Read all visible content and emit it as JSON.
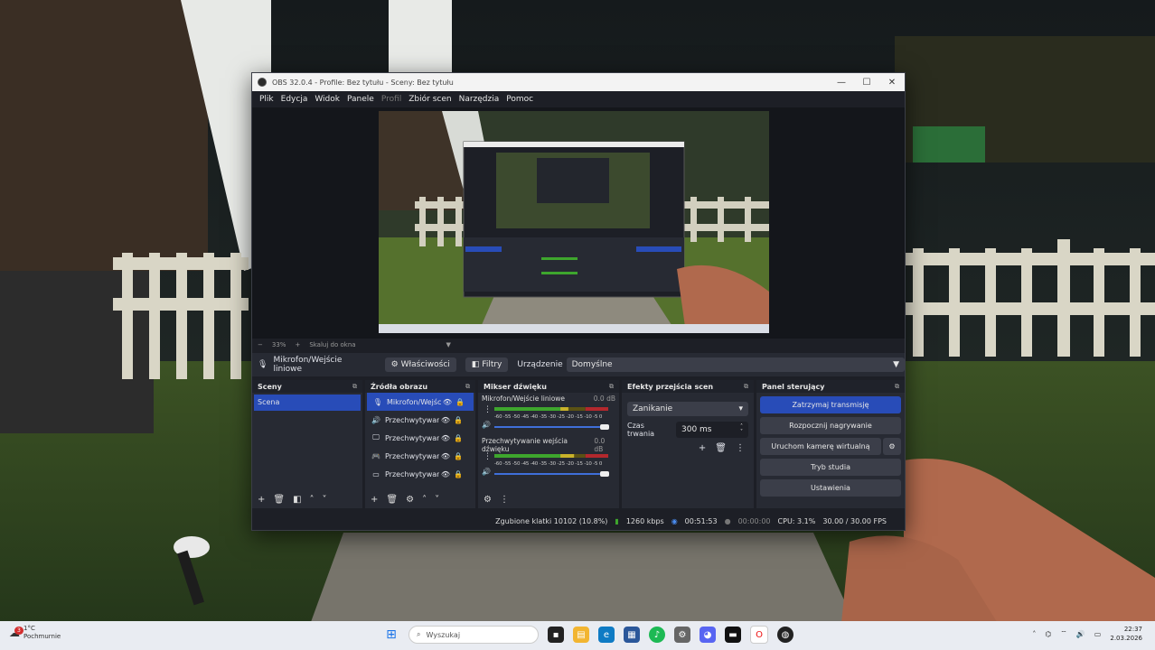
{
  "window": {
    "title": "OBS 32.0.4 - Profile: Bez tytułu - Sceny: Bez tytułu",
    "controls": [
      "—",
      "☐",
      "✕"
    ]
  },
  "menu": [
    {
      "label": "Plik",
      "enabled": true
    },
    {
      "label": "Edycja",
      "enabled": true
    },
    {
      "label": "Widok",
      "enabled": true
    },
    {
      "label": "Panele",
      "enabled": true
    },
    {
      "label": "Profil",
      "enabled": false
    },
    {
      "label": "Zbiór scen",
      "enabled": true
    },
    {
      "label": "Narzędzia",
      "enabled": true
    },
    {
      "label": "Pomoc",
      "enabled": true
    }
  ],
  "zoom": {
    "minus": "−",
    "value": "33%",
    "plus": "+",
    "scale_label": "Skaluj do okna"
  },
  "source_bar": {
    "source_name": "Mikrofon/Wejście liniowe",
    "properties": "Właściwości",
    "filters": "Filtry",
    "device_label": "Urządzenie",
    "device_value": "Domyślne"
  },
  "scenes": {
    "title": "Sceny",
    "items": [
      "Scena"
    ]
  },
  "sources": {
    "title": "Źródła obrazu",
    "items": [
      {
        "label": "Mikrofon/Wejście liniowe",
        "icon": "microphone-icon",
        "glyph": "🎙",
        "active": true
      },
      {
        "label": "Przechwytywanie wejścia dźwięku",
        "icon": "speaker-icon",
        "glyph": "🔊",
        "active": false
      },
      {
        "label": "Przechwytywanie ekranu",
        "icon": "monitor-icon",
        "glyph": "🖵",
        "active": false
      },
      {
        "label": "Przechwytywanie gry",
        "icon": "gamepad-icon",
        "glyph": "🎮",
        "active": false
      },
      {
        "label": "Przechwytywanie okna",
        "icon": "window-icon",
        "glyph": "▭",
        "active": false
      }
    ]
  },
  "mixer": {
    "title": "Mikser dźwięku",
    "channels": [
      {
        "name": "Mikrofon/Wejście liniowe",
        "db": "0.0 dB",
        "level": 0.65
      },
      {
        "name": "Przechwytywanie wejścia dźwięku",
        "db": "0.0 dB",
        "level": 0.7
      }
    ],
    "ticks": "-60 -55 -50 -45 -40 -35 -30 -25 -20 -15 -10 -5 0"
  },
  "transitions": {
    "title": "Efekty przejścia scen",
    "selected": "Zanikanie",
    "duration_label": "Czas trwania",
    "duration_value": "300 ms"
  },
  "controls": {
    "title": "Panel sterujący",
    "stop_stream": "Zatrzymaj transmisję",
    "start_record": "Rozpocznij nagrywanie",
    "virtual_cam": "Uruchom kamerę wirtualną",
    "studio_mode": "Tryb studia",
    "settings": "Ustawienia"
  },
  "status": {
    "dropped": "Zgubione klatki 10102 (10.8%)",
    "bitrate": "1260 kbps",
    "stream_time": "00:51:53",
    "record_time": "00:00:00",
    "cpu": "CPU: 3.1%",
    "fps": "30.00 / 30.00 FPS"
  },
  "taskbar": {
    "weather_temp": "1°C",
    "weather_desc": "Pochmurnie",
    "weather_badge": "3",
    "search_placeholder": "Wyszukaj",
    "time": "22:37",
    "date": "2.03.2026"
  },
  "colors": {
    "accent": "#284cb8",
    "panel": "#272a33",
    "meter_green": "#3ea62d",
    "meter_yellow": "#c9b22a",
    "meter_red": "#b3282d"
  }
}
